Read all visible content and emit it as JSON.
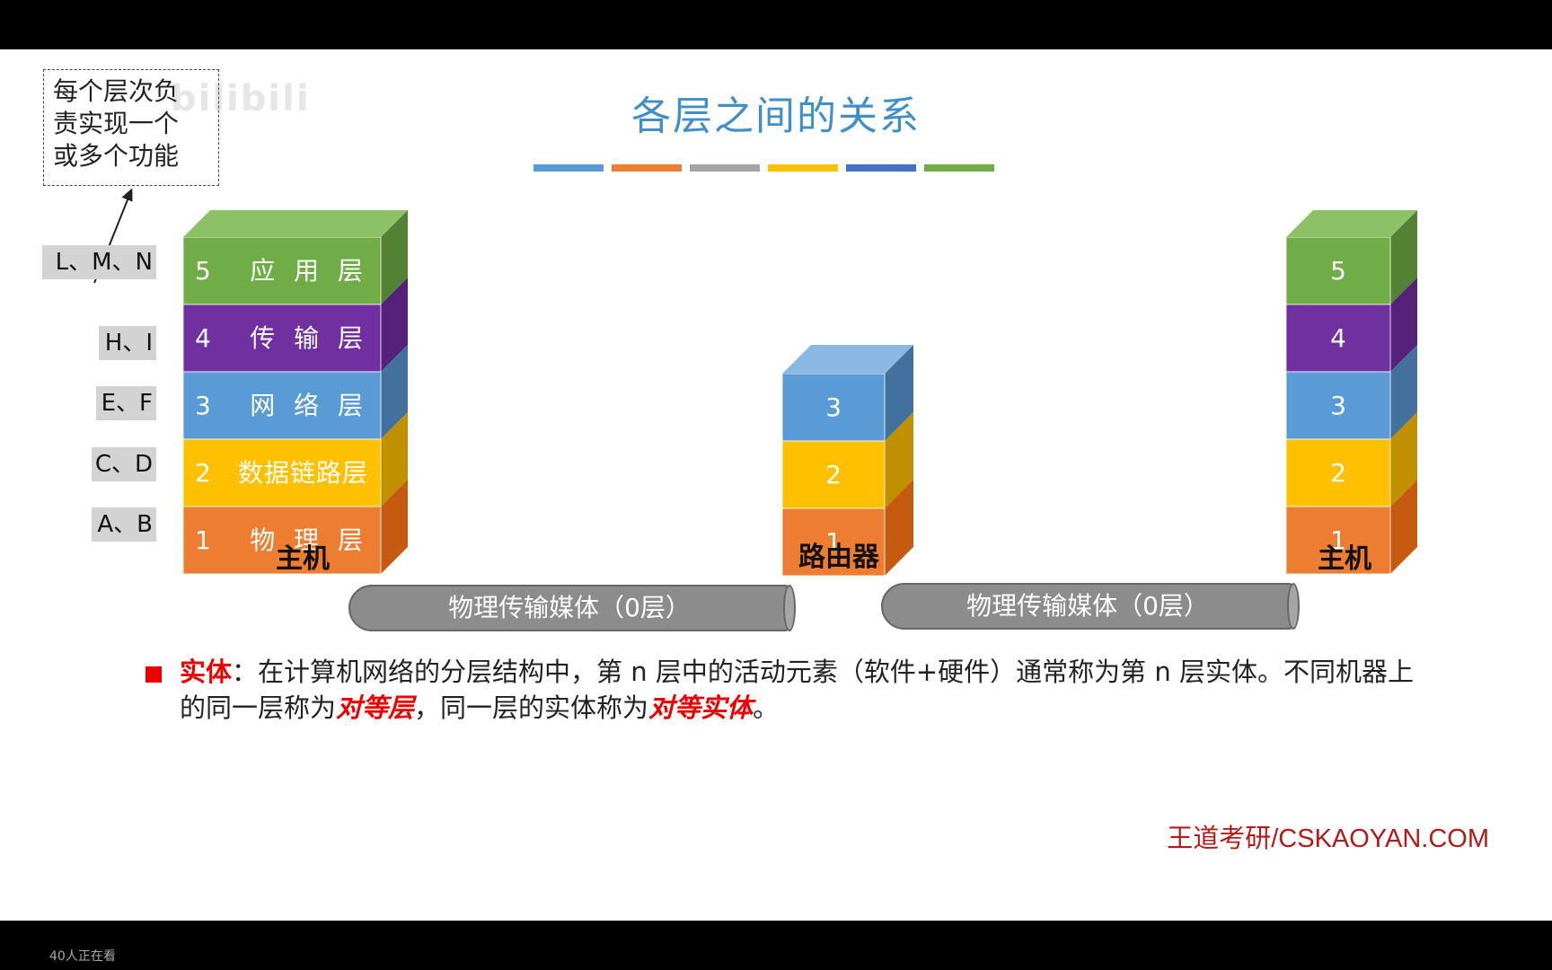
{
  "title": "各层之间的关系",
  "title_bar_colors": [
    "#5b9bd5",
    "#ed7d31",
    "#a5a5a5",
    "#ffc000",
    "#4472c4",
    "#70ad47"
  ],
  "watermark": "bilibili",
  "note_box": {
    "lines": [
      "每个层次负",
      "责实现一个",
      "或多个功能"
    ]
  },
  "side_labels": [
    "L、M、N",
    "H、I",
    "E、F",
    "C、D",
    "A、B"
  ],
  "left_host": {
    "label": "主机",
    "layers": [
      {
        "num": "5",
        "name": "应 用 层",
        "color": "#70ad47",
        "side": "#548235",
        "top": "#8cc168"
      },
      {
        "num": "4",
        "name": "传 输 层",
        "color": "#7030a0",
        "side": "#55227a",
        "top": "#8a4cb8"
      },
      {
        "num": "3",
        "name": "网 络 层",
        "color": "#5b9bd5",
        "side": "#41719c",
        "top": "#8cb9e3"
      },
      {
        "num": "2",
        "name": "数据链路层",
        "color": "#ffc000",
        "side": "#c09000",
        "top": "#ffd24d"
      },
      {
        "num": "1",
        "name": "物 理 层",
        "color": "#ed7d31",
        "side": "#c55a11",
        "top": "#f2a06a"
      }
    ]
  },
  "router": {
    "label": "路由器",
    "layers": [
      {
        "num": "3",
        "color": "#5b9bd5",
        "side": "#41719c",
        "top": "#8cb9e3"
      },
      {
        "num": "2",
        "color": "#ffc000",
        "side": "#c09000",
        "top": "#ffd24d"
      },
      {
        "num": "1",
        "color": "#ed7d31",
        "side": "#c55a11",
        "top": "#f2a06a"
      }
    ]
  },
  "right_host": {
    "label": "主机",
    "layers": [
      {
        "num": "5",
        "color": "#70ad47",
        "side": "#548235",
        "top": "#8cc168"
      },
      {
        "num": "4",
        "color": "#7030a0",
        "side": "#55227a",
        "top": "#8a4cb8"
      },
      {
        "num": "3",
        "color": "#5b9bd5",
        "side": "#41719c",
        "top": "#8cb9e3"
      },
      {
        "num": "2",
        "color": "#ffc000",
        "side": "#c09000",
        "top": "#ffd24d"
      },
      {
        "num": "1",
        "color": "#ed7d31",
        "side": "#c55a11",
        "top": "#f2a06a"
      }
    ]
  },
  "cables": [
    "物理传输媒体（0层）",
    "物理传输媒体（0层）"
  ],
  "description": {
    "term": "实体",
    "part1": "：在计算机网络的分层结构中，第 n 层中的活动元素（软件+硬件）通常称为第 n 层实体。不同机器上的同一层称为",
    "em1": "对等层",
    "part2": "，同一层的实体称为",
    "em2": "对等实体",
    "part3": "。"
  },
  "brand": "王道考研/CSKAOYAN.COM",
  "viewers": "40人正在看"
}
